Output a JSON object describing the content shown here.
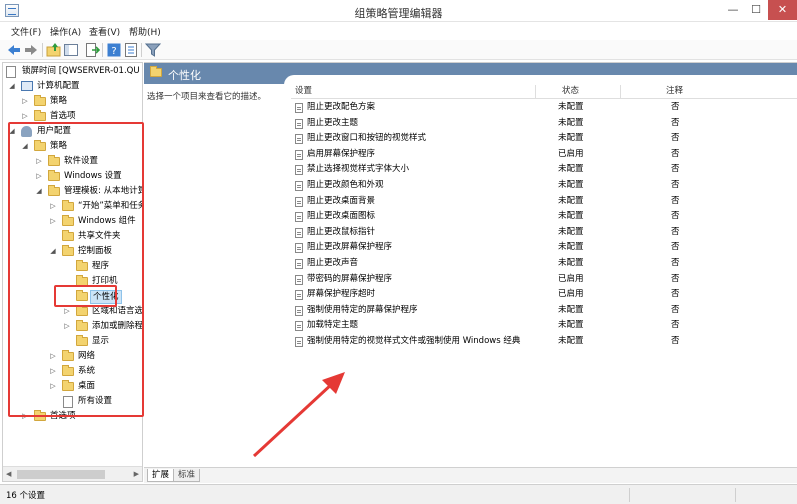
{
  "window": {
    "title": "组策略管理编辑器",
    "btn_min": "—",
    "btn_max": "☐",
    "btn_close": "✕"
  },
  "menu": [
    "文件(F)",
    "操作(A)",
    "查看(V)",
    "帮助(H)"
  ],
  "toolbar_icons": [
    "back-arrow-icon",
    "forward-arrow-icon",
    "up-folder-icon",
    "show-hide-tree-icon",
    "export-list-icon",
    "help-icon",
    "properties-icon",
    "filter-icon"
  ],
  "tree": {
    "root": "锁屏时间 [QWSERVER-01.QU",
    "computer_config": "计算机配置",
    "cc_policies": "策略",
    "cc_preferences": "首选项",
    "user_config": "用户配置",
    "uc_policies": "策略",
    "software_settings": "软件设置",
    "windows_settings": "Windows 设置",
    "admin_templates": "管理模板: 从本地计算",
    "start_menu": "“开始”菜单和任务",
    "windows_components": "Windows 组件",
    "shared_folders": "共享文件夹",
    "control_panel": "控制面板",
    "programs": "程序",
    "printers": "打印机",
    "personalization": "个性化",
    "regional": "区域和语言选项",
    "add_remove": "添加或删除程序",
    "display": "显示",
    "network": "网络",
    "system": "系统",
    "desktop": "桌面",
    "all_settings": "所有设置",
    "uc_preferences": "首选项"
  },
  "right": {
    "header_title": "个性化",
    "description": "选择一个项目来查看它的描述。",
    "col_setting": "设置",
    "col_state": "状态",
    "col_note": "注释",
    "rows": [
      {
        "name": "阻止更改配色方案",
        "state": "未配置",
        "note": "否"
      },
      {
        "name": "阻止更改主题",
        "state": "未配置",
        "note": "否"
      },
      {
        "name": "阻止更改窗口和按钮的视觉样式",
        "state": "未配置",
        "note": "否"
      },
      {
        "name": "启用屏幕保护程序",
        "state": "已启用",
        "note": "否"
      },
      {
        "name": "禁止选择视觉样式字体大小",
        "state": "未配置",
        "note": "否"
      },
      {
        "name": "阻止更改颜色和外观",
        "state": "未配置",
        "note": "否"
      },
      {
        "name": "阻止更改桌面背景",
        "state": "未配置",
        "note": "否"
      },
      {
        "name": "阻止更改桌面图标",
        "state": "未配置",
        "note": "否"
      },
      {
        "name": "阻止更改鼠标指针",
        "state": "未配置",
        "note": "否"
      },
      {
        "name": "阻止更改屏幕保护程序",
        "state": "未配置",
        "note": "否"
      },
      {
        "name": "阻止更改声音",
        "state": "未配置",
        "note": "否"
      },
      {
        "name": "带密码的屏幕保护程序",
        "state": "已启用",
        "note": "否"
      },
      {
        "name": "屏幕保护程序超时",
        "state": "已启用",
        "note": "否"
      },
      {
        "name": "强制使用特定的屏幕保护程序",
        "state": "未配置",
        "note": "否"
      },
      {
        "name": "加载特定主题",
        "state": "未配置",
        "note": "否"
      },
      {
        "name": "强制使用特定的视觉样式文件或强制使用 Windows 经典",
        "state": "未配置",
        "note": "否"
      }
    ],
    "tab_extended": "扩展",
    "tab_standard": "标准"
  },
  "status": {
    "text": "16 个设置"
  },
  "annotation_color": "#e53935"
}
